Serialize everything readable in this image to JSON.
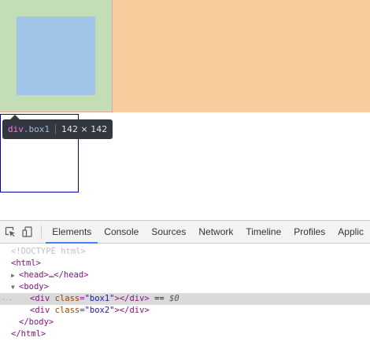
{
  "tooltip": {
    "tag": "div",
    "class_name": ".box1",
    "dimensions": "142 × 142"
  },
  "toolbar": {
    "tabs": [
      "Elements",
      "Console",
      "Sources",
      "Network",
      "Timeline",
      "Profiles",
      "Applic"
    ],
    "active_tab": "Elements"
  },
  "dom": {
    "doctype": "<!DOCTYPE html>",
    "html_open": "<html>",
    "head_open": "<head>",
    "head_ellipsis": "…",
    "head_close": "</head>",
    "body_open": "<body>",
    "box1": {
      "tag": "div",
      "attr": "class",
      "value": "\"box1\"",
      "close": "></div>",
      "marker": " == ",
      "dollar": "$0"
    },
    "box2": {
      "tag": "div",
      "attr": "class",
      "value": "\"box2\"",
      "close": "></div>"
    },
    "body_close": "</body>",
    "html_close": "</html>",
    "gutter_ellipsis": "..."
  },
  "colors": {
    "margin": "#f9cc9d",
    "padding": "#c3deb7",
    "content": "#a0c5e8",
    "box2_border": "#0000aa",
    "tab_active": "#3e82f7",
    "selected_row": "#dadada"
  },
  "icons": {
    "inspect": "cursor-in-box-icon",
    "device": "device-mode-icon"
  }
}
